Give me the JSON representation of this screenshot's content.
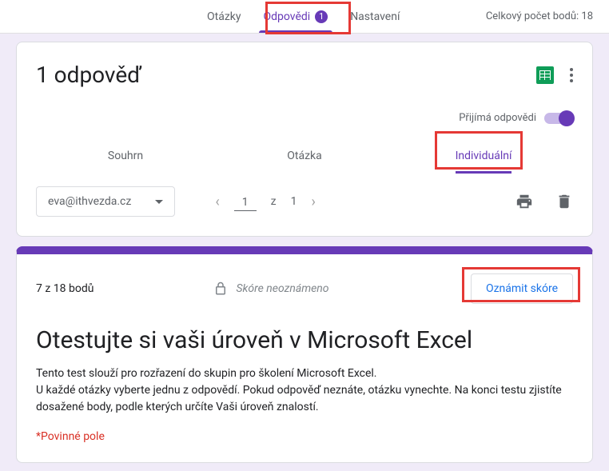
{
  "header": {
    "tabs": [
      {
        "label": "Otázky"
      },
      {
        "label": "Odpovědi",
        "badge": "1"
      },
      {
        "label": "Nastavení"
      }
    ],
    "total_score": "Celkový počet bodů: 18"
  },
  "responses_card": {
    "title": "1 odpověď",
    "accepting_label": "Přijímá odpovědi",
    "inner_tabs": [
      {
        "label": "Souhrn"
      },
      {
        "label": "Otázka"
      },
      {
        "label": "Individuální"
      }
    ],
    "email": "eva@ithvezda.cz",
    "pager": {
      "current": "1",
      "separator": "z",
      "total": "1"
    }
  },
  "response_view": {
    "score": "7 z 18 bodů",
    "status": "Skóre neoznámeno",
    "announce_button": "Oznámit skóre",
    "form_title": "Otestujte si vaši úroveň v Microsoft Excel",
    "form_desc_line1": "Tento test slouží pro rozřazení do skupin pro školení Microsoft Excel.",
    "form_desc_line2": "U každé otázky vyberte jednu z odpovědí. Pokud odpověď neznáte, otázku vynechte. Na konci testu zjistíte dosažené body, podle kterých určíte Vaši úroveň znalostí.",
    "required": "*Povinné pole"
  }
}
